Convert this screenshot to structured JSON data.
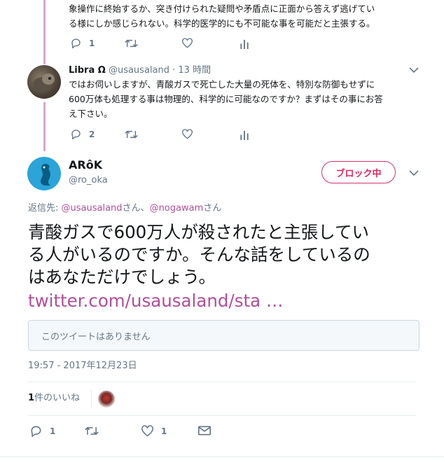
{
  "thread": {
    "prev_tweet": {
      "line1": "象操作に終始するか、突き付けられた疑問や矛盾点に正面から答えず逃げてい",
      "line2": "る様にしか感じられない。科学的医学的にも不可能な事を可能だと主張する。",
      "reply_count": "1"
    },
    "libra_tweet": {
      "name": "Libra Ω",
      "handle": "@usausaland",
      "time": "· 13 時間",
      "line1": "ではお伺いしますが、青酸ガスで死亡した大量の死体を、特別な防御もせずに",
      "line2": "600万体も処理する事は物理的、科学的に可能なのですか？まずはその事にお答",
      "line3": "え下さい。",
      "reply_count": "2"
    }
  },
  "main_tweet": {
    "name": "ARôK",
    "handle": "@ro_oka",
    "block_button": "ブロック中",
    "reply_to": {
      "prefix": "返信先: ",
      "user1": "@usausaland",
      "sep": "さん、",
      "user2": "@nogawam",
      "suffix": "さん"
    },
    "body_line1": "青酸ガスで600万人が殺されたと主張してい",
    "body_line2": "る人がいるのですか。そんな話をしているの",
    "body_line3": "はあなただけでしょう。",
    "link": "twitter.com/usausaland/sta …",
    "quote_unavailable": "このツイートはありません",
    "timestamp": "19:57 - 2017年12月23日",
    "likes_count": "1",
    "likes_label": "件のいいね",
    "reply_count": "1",
    "like_count": "1"
  },
  "colors": {
    "accent": "#b24e9a",
    "block": "#e0245e",
    "thread_line": "#d7a7d0",
    "muted": "#657786"
  }
}
